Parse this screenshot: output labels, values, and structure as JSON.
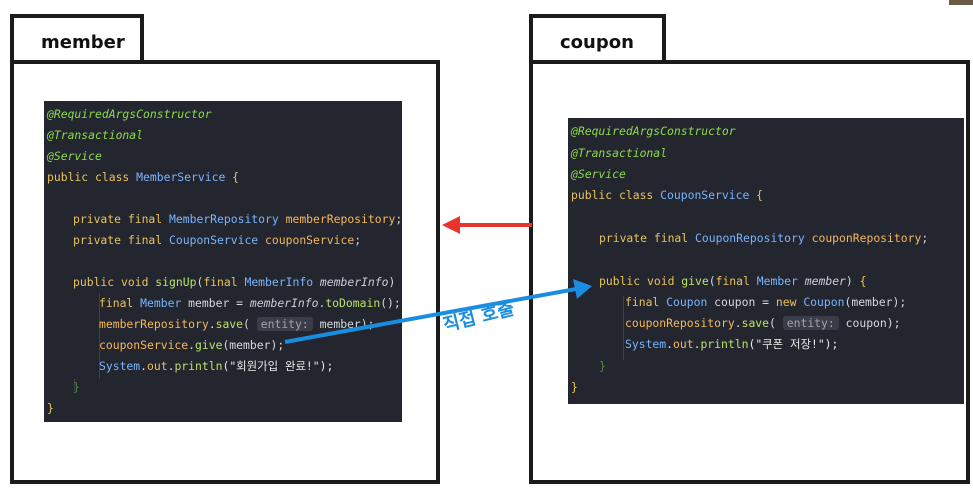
{
  "member": {
    "tab_label": "member",
    "code": {
      "l1": "@RequiredArgsConstructor",
      "l2": "@Transactional",
      "l3": "@Service",
      "l4_kw": "public class ",
      "l4_cls": "MemberService",
      "l4_brace": " {",
      "l6_kw": "private final ",
      "l6_cls": "MemberRepository",
      "l6_fld": "memberRepository",
      "l6_end": ";",
      "l7_kw": "private final ",
      "l7_cls": "CouponService",
      "l7_fld": "couponService",
      "l7_end": ";",
      "l9_kw": "public void ",
      "l9_mth": "signUp",
      "l9_p1": "(",
      "l9_kw2": "final ",
      "l9_cls": "MemberInfo ",
      "l9_it": "memberInfo",
      "l9_p2": ") ",
      "l9_brace": "{",
      "l10_kw": "final ",
      "l10_cls": "Member",
      "l10_mid": " member = ",
      "l10_it": "memberInfo",
      "l10_dot": ".",
      "l10_mth": "toDomain",
      "l10_end": "();",
      "l11_fld": "memberRepository",
      "l11_dot": ".",
      "l11_mth": "save",
      "l11_p": "( ",
      "l11_hint": "entity:",
      "l11_end": " member);",
      "l12_fld": "couponService",
      "l12_dot": ".",
      "l12_mth": "give",
      "l12_end": "(member);",
      "l13_cls": "System",
      "l13_dot": ".",
      "l13_fld": "out",
      "l13_dot2": ".",
      "l13_mth": "println",
      "l13_str": "(\"회원가입 완료!\");",
      "l14": "}",
      "l15": "}"
    }
  },
  "coupon": {
    "tab_label": "coupon",
    "code": {
      "l1": "@RequiredArgsConstructor",
      "l2": "@Transactional",
      "l3": "@Service",
      "l4_kw": "public class ",
      "l4_cls": "CouponService",
      "l4_brace": " {",
      "l6_kw": "private final ",
      "l6_cls": "CouponRepository",
      "l6_fld": "couponRepository",
      "l6_end": ";",
      "l8_kw": "public void ",
      "l8_mth": "give",
      "l8_p1": "(",
      "l8_kw2": "final ",
      "l8_cls": "Member ",
      "l8_it": "member",
      "l8_p2": ") ",
      "l8_brace": "{",
      "l9_kw": "final ",
      "l9_cls": "Coupon",
      "l9_mid": " coupon = ",
      "l9_kw2": "new ",
      "l9_cls2": "Coupon",
      "l9_end": "(member);",
      "l10_fld": "couponRepository",
      "l10_dot": ".",
      "l10_mth": "save",
      "l10_p": "( ",
      "l10_hint": "entity:",
      "l10_end": " coupon);",
      "l11_cls": "System",
      "l11_dot": ".",
      "l11_fld": "out",
      "l11_dot2": ".",
      "l11_mth": "println",
      "l11_str": "(\"쿠폰 저장!\");",
      "l12": "}",
      "l13": "}"
    }
  },
  "callout": "직접 호출",
  "colors": {
    "red_arrow": "#e8342a",
    "blue_arrow": "#1a8de0"
  }
}
